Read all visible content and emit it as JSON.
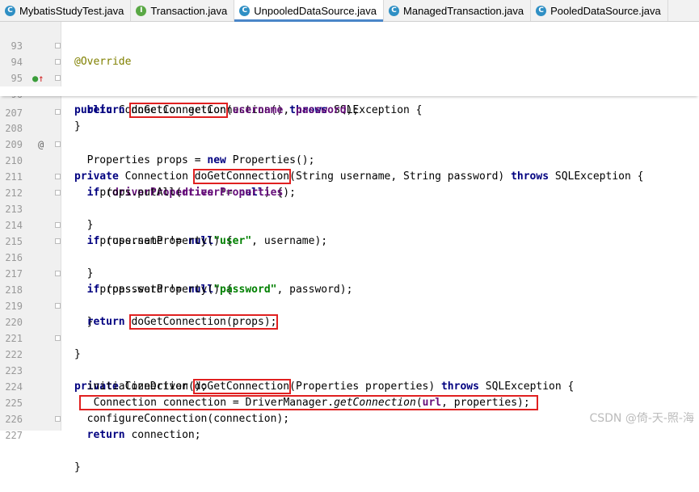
{
  "tabs": [
    {
      "label": "MybatisStudyTest.java",
      "icon": "c",
      "active": false
    },
    {
      "label": "Transaction.java",
      "icon": "i",
      "active": false
    },
    {
      "label": "UnpooledDataSource.java",
      "icon": "cl",
      "active": true
    },
    {
      "label": "ManagedTransaction.java",
      "icon": "cl",
      "active": false
    },
    {
      "label": "PooledDataSource.java",
      "icon": "cl",
      "active": false
    }
  ],
  "lines": {
    "l93": {
      "num": "93",
      "anno": "@Override"
    },
    "l94": {
      "num": "94",
      "public": "public",
      "conn": "Connection",
      "name": "getConnection",
      "paren": "()",
      "throws": "throws",
      "exc": "SQLException {"
    },
    "l95": {
      "num": "95",
      "ret": "return",
      "call": "doGetConnection",
      "rest1": "(",
      "f1": "username",
      "sep": ", ",
      "f2": "password",
      "rest2": ");"
    },
    "l96": {
      "num": "96",
      "brace": "}"
    },
    "l207": {
      "num": "207"
    },
    "l208": {
      "num": "208",
      "mod": "private",
      "conn": "Connection",
      "call": "doGetConnection",
      "params": "(String username, String password)",
      "throws": "throws",
      "exc": "SQLException {"
    },
    "l209": {
      "num": "209",
      "a": "Properties props = ",
      "new": "new",
      "b": "Properties();"
    },
    "l210": {
      "num": "210",
      "if": "if",
      "a": " (",
      "fld": "driverProperties",
      "b": " != ",
      "nul": "null",
      "c": ") {"
    },
    "l211": {
      "num": "211",
      "a": "props.putAll(",
      "fld": "driverProperties",
      "b": ");"
    },
    "l212": {
      "num": "212",
      "brace": "}"
    },
    "l213": {
      "num": "213",
      "if": "if",
      "a": " (username != ",
      "nul": "null",
      "c": ") {"
    },
    "l214": {
      "num": "214",
      "a": "props.setProperty(",
      "str": "\"user\"",
      "b": ", username);"
    },
    "l215": {
      "num": "215",
      "brace": "}"
    },
    "l216": {
      "num": "216",
      "if": "if",
      "a": " (password != ",
      "nul": "null",
      "c": ") {"
    },
    "l217": {
      "num": "217",
      "a": "props.setProperty(",
      "str": "\"password\"",
      "b": ", password);"
    },
    "l218": {
      "num": "218",
      "brace": "}"
    },
    "l219": {
      "num": "219",
      "ret": "return",
      "call": "doGetConnection(props);"
    },
    "l220": {
      "num": "220",
      "brace": "}"
    },
    "l221": {
      "num": "221"
    },
    "l222": {
      "num": "222",
      "mod": "private",
      "conn": "Connection",
      "call": "doGetConnection",
      "params": "(Properties properties)",
      "throws": "throws",
      "exc": "SQLException {"
    },
    "l223": {
      "num": "223",
      "a": "initializeDriver();"
    },
    "l224": {
      "num": "224",
      "a": "Connection connection = DriverManager.",
      "it": "getConnection",
      "b": "(",
      "fld": "url",
      "c": ", properties);"
    },
    "l225": {
      "num": "225",
      "a": "configureConnection(connection);"
    },
    "l226": {
      "num": "226",
      "ret": "return",
      "a": " connection;"
    },
    "l227": {
      "num": "227",
      "brace": "}"
    }
  },
  "watermark": "CSDN @倚-天-照-海"
}
